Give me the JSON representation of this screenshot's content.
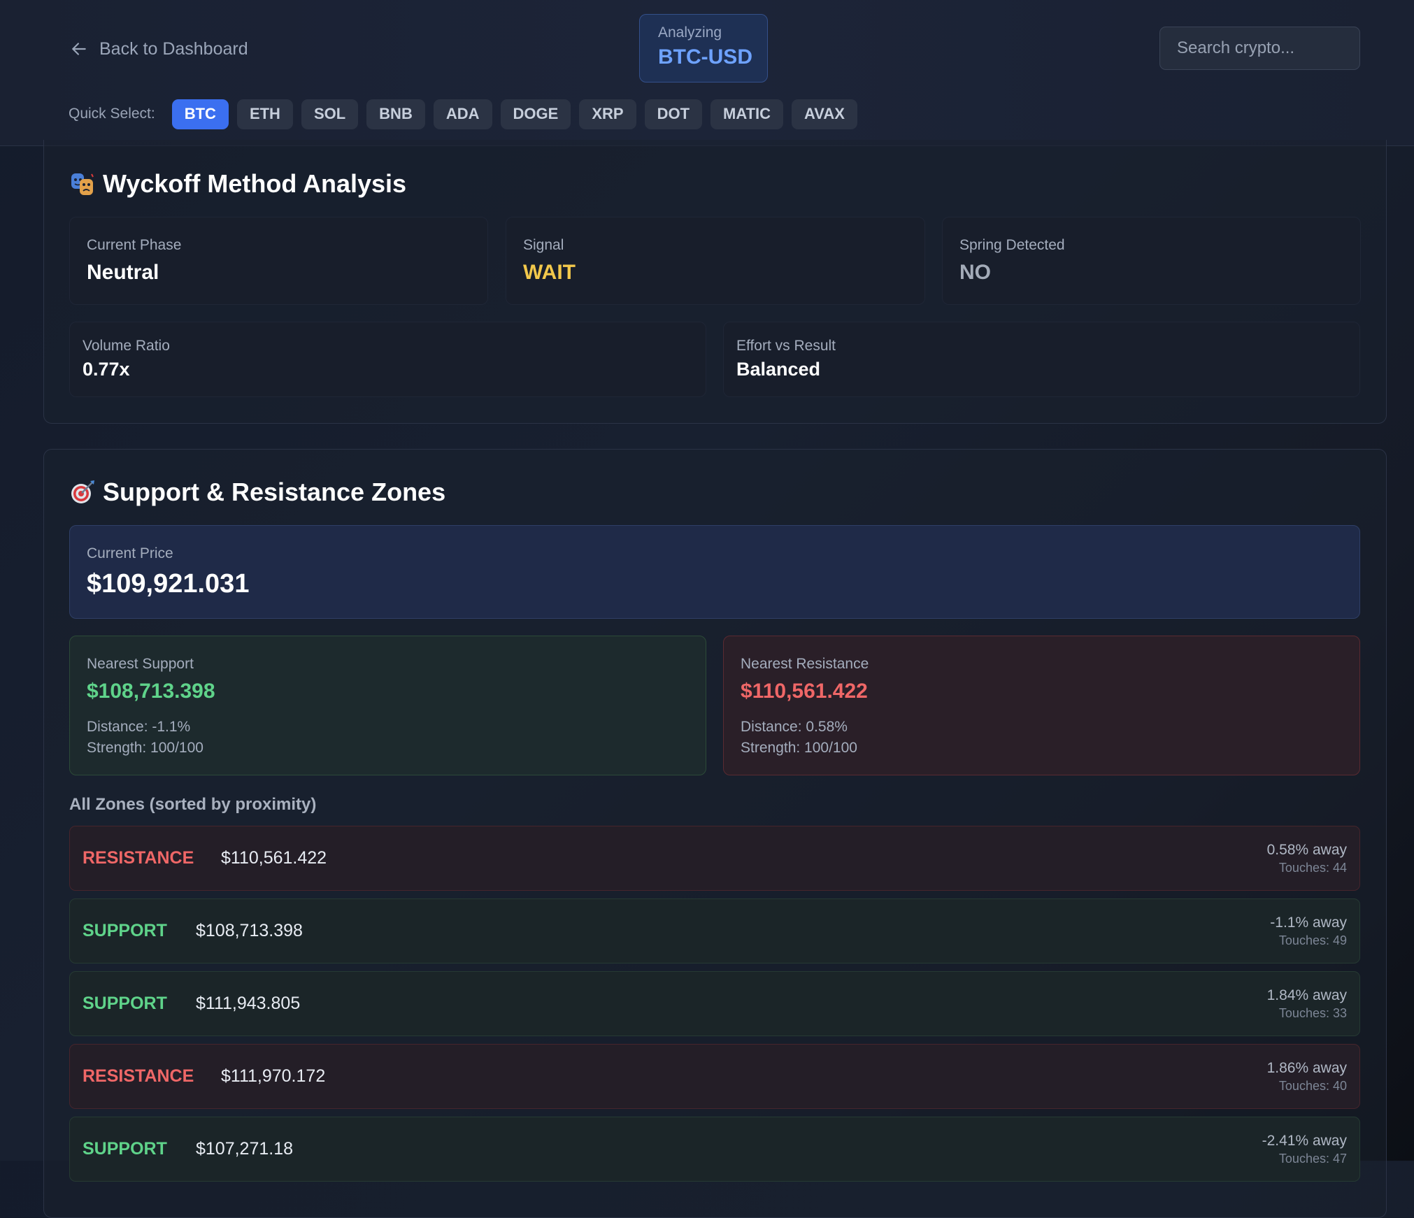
{
  "header": {
    "back_label": "Back to Dashboard",
    "analyzing_label": "Analyzing",
    "analyzing_symbol": "BTC-USD",
    "search_placeholder": "Search crypto...",
    "quick_select_label": "Quick Select:",
    "quick_select": [
      "BTC",
      "ETH",
      "SOL",
      "BNB",
      "ADA",
      "DOGE",
      "XRP",
      "DOT",
      "MATIC",
      "AVAX"
    ],
    "quick_select_active": "BTC"
  },
  "wyckoff": {
    "title": "Wyckoff Method Analysis",
    "icon": "theater-masks-icon",
    "current_phase_label": "Current Phase",
    "current_phase_value": "Neutral",
    "signal_label": "Signal",
    "signal_value": "WAIT",
    "spring_label": "Spring Detected",
    "spring_value": "NO",
    "volume_ratio_label": "Volume Ratio",
    "volume_ratio_value": "0.77x",
    "effort_label": "Effort vs Result",
    "effort_value": "Balanced"
  },
  "sr": {
    "title": "Support & Resistance Zones",
    "icon": "dart-target-icon",
    "current_price_label": "Current Price",
    "current_price_value": "$109,921.031",
    "nearest_support": {
      "label": "Nearest Support",
      "value": "$108,713.398",
      "distance": "Distance: -1.1%",
      "strength": "Strength: 100/100"
    },
    "nearest_resistance": {
      "label": "Nearest Resistance",
      "value": "$110,561.422",
      "distance": "Distance: 0.58%",
      "strength": "Strength: 100/100"
    },
    "zones_title": "All Zones (sorted by proximity)",
    "zones": [
      {
        "type": "RESISTANCE",
        "price": "$110,561.422",
        "away": "0.58% away",
        "touches": "Touches: 44"
      },
      {
        "type": "SUPPORT",
        "price": "$108,713.398",
        "away": "-1.1% away",
        "touches": "Touches: 49"
      },
      {
        "type": "SUPPORT",
        "price": "$111,943.805",
        "away": "1.84% away",
        "touches": "Touches: 33"
      },
      {
        "type": "RESISTANCE",
        "price": "$111,970.172",
        "away": "1.86% away",
        "touches": "Touches: 40"
      },
      {
        "type": "SUPPORT",
        "price": "$107,271.18",
        "away": "-2.41% away",
        "touches": "Touches: 47"
      }
    ]
  },
  "colors": {
    "accent_blue": "#3b6ff0",
    "support_green": "#5fd38a",
    "resistance_red": "#ef6767",
    "signal_yellow": "#f2c84b"
  }
}
